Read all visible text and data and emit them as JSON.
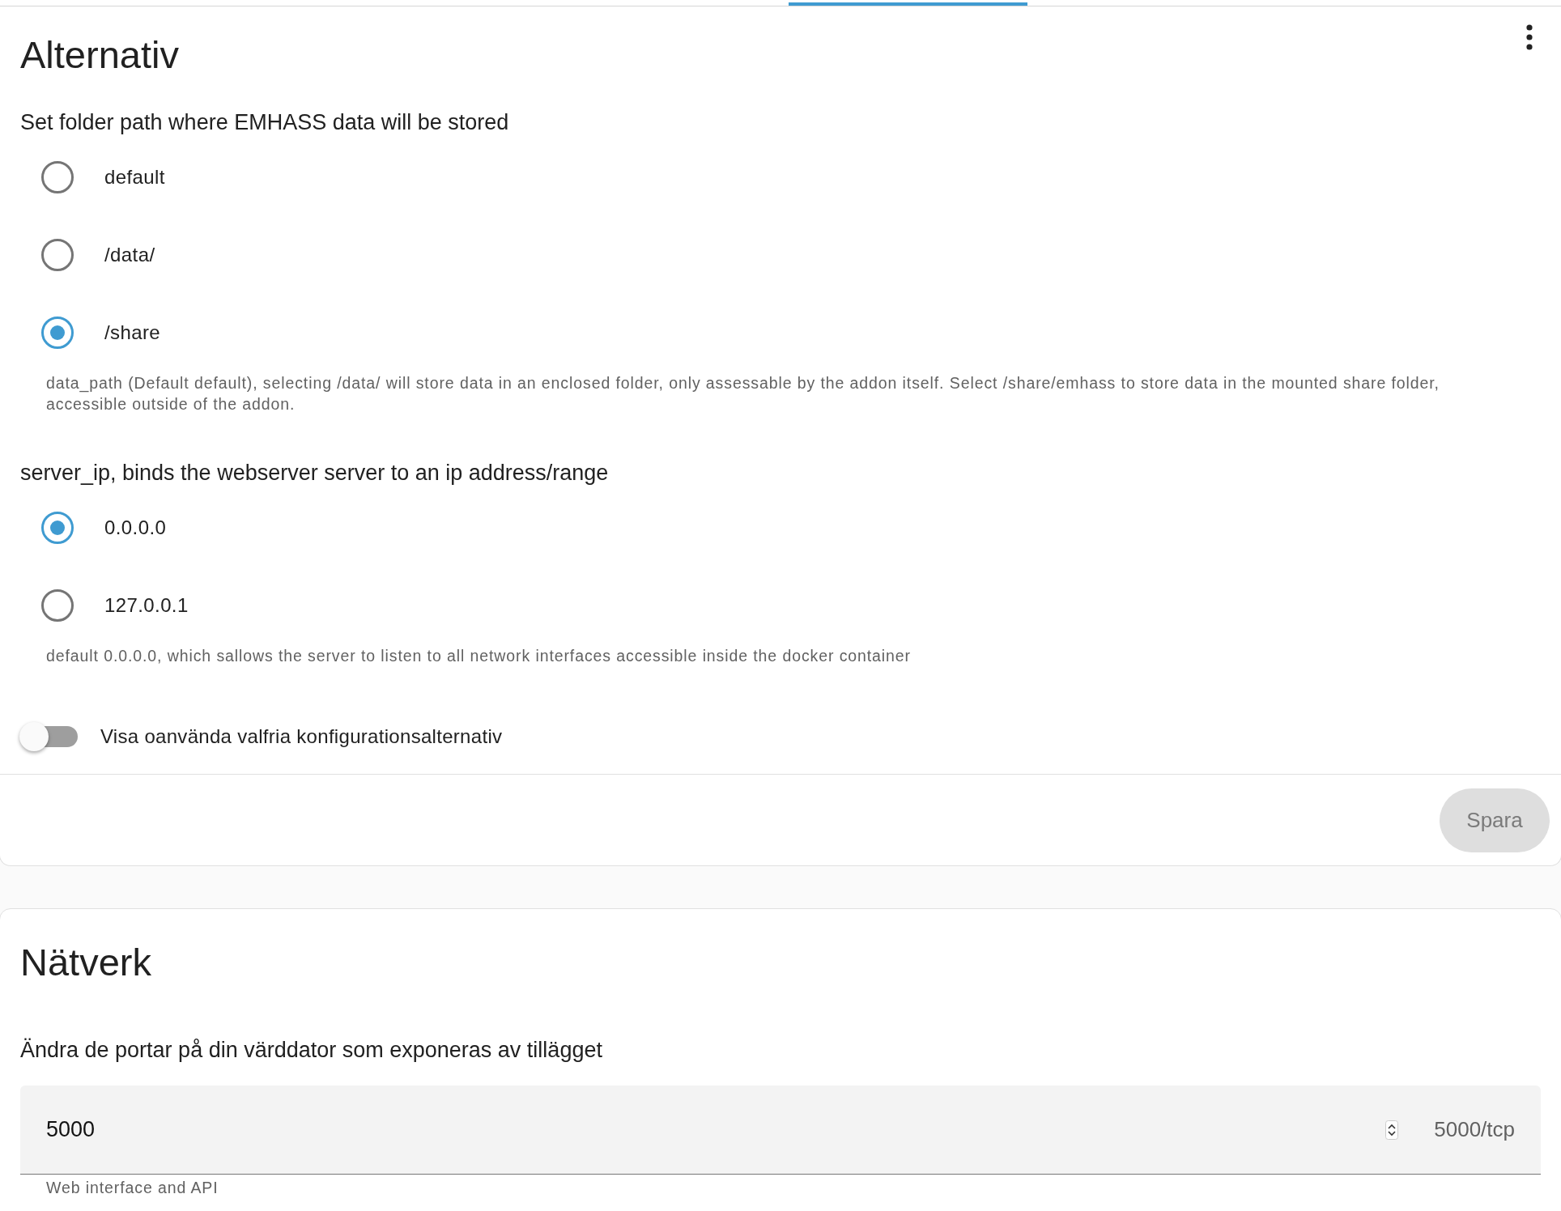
{
  "config_card": {
    "title": "Alternativ",
    "options": [
      {
        "kind": "radio",
        "label": "Set folder path where EMHASS data will be stored",
        "choices": [
          {
            "label": "default",
            "selected": false
          },
          {
            "label": "/data/",
            "selected": false
          },
          {
            "label": "/share",
            "selected": true
          }
        ],
        "help": "data_path (Default default), selecting /data/ will store data in an enclosed folder, only assessable by the addon itself. Select /share/emhass to store data in the mounted share folder, accessible outside of the addon."
      },
      {
        "kind": "radio",
        "label": "server_ip, binds the webserver server to an ip address/range",
        "choices": [
          {
            "label": "0.0.0.0",
            "selected": true
          },
          {
            "label": "127.0.0.1",
            "selected": false
          }
        ],
        "help": "default 0.0.0.0, which sallows the server to listen to all network interfaces accessible inside the docker container"
      },
      {
        "kind": "toggle",
        "label": "Visa oanvända valfria konfigurationsalternativ",
        "on": false
      }
    ],
    "save_button": {
      "label": "Spara",
      "disabled": true
    }
  },
  "network_card": {
    "title": "Nätverk",
    "description": "Ändra de portar på din värddator som exponeras av tillägget",
    "ports": [
      {
        "value": "5000",
        "suffix": "5000/tcp",
        "help": "Web interface and API"
      }
    ]
  }
}
